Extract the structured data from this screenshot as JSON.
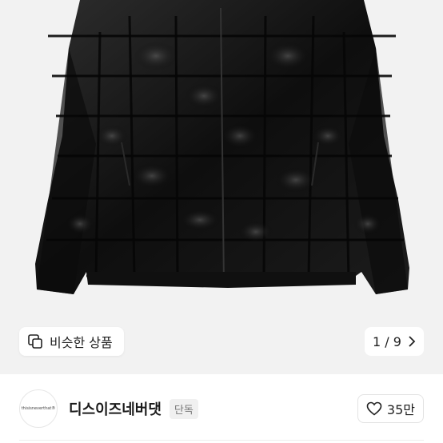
{
  "product": {
    "image_alt": "black puffer jacket",
    "similar_label": "비슷한 상품",
    "page_current": "1",
    "page_total": "9",
    "page_text": "1 / 9"
  },
  "seller": {
    "avatar_text": "thisisneverthat®",
    "name": "디스이즈네버댓",
    "badge": "단독"
  },
  "likes": {
    "count": "35만"
  },
  "icons": {
    "similar": "similar-products-icon",
    "chevron": "chevron-right-icon",
    "heart": "heart-icon"
  },
  "colors": {
    "image_bg": "#f2f2f2",
    "jacket": "#141414",
    "text": "#1a1a1a",
    "badge_bg": "#f0f0f0"
  }
}
